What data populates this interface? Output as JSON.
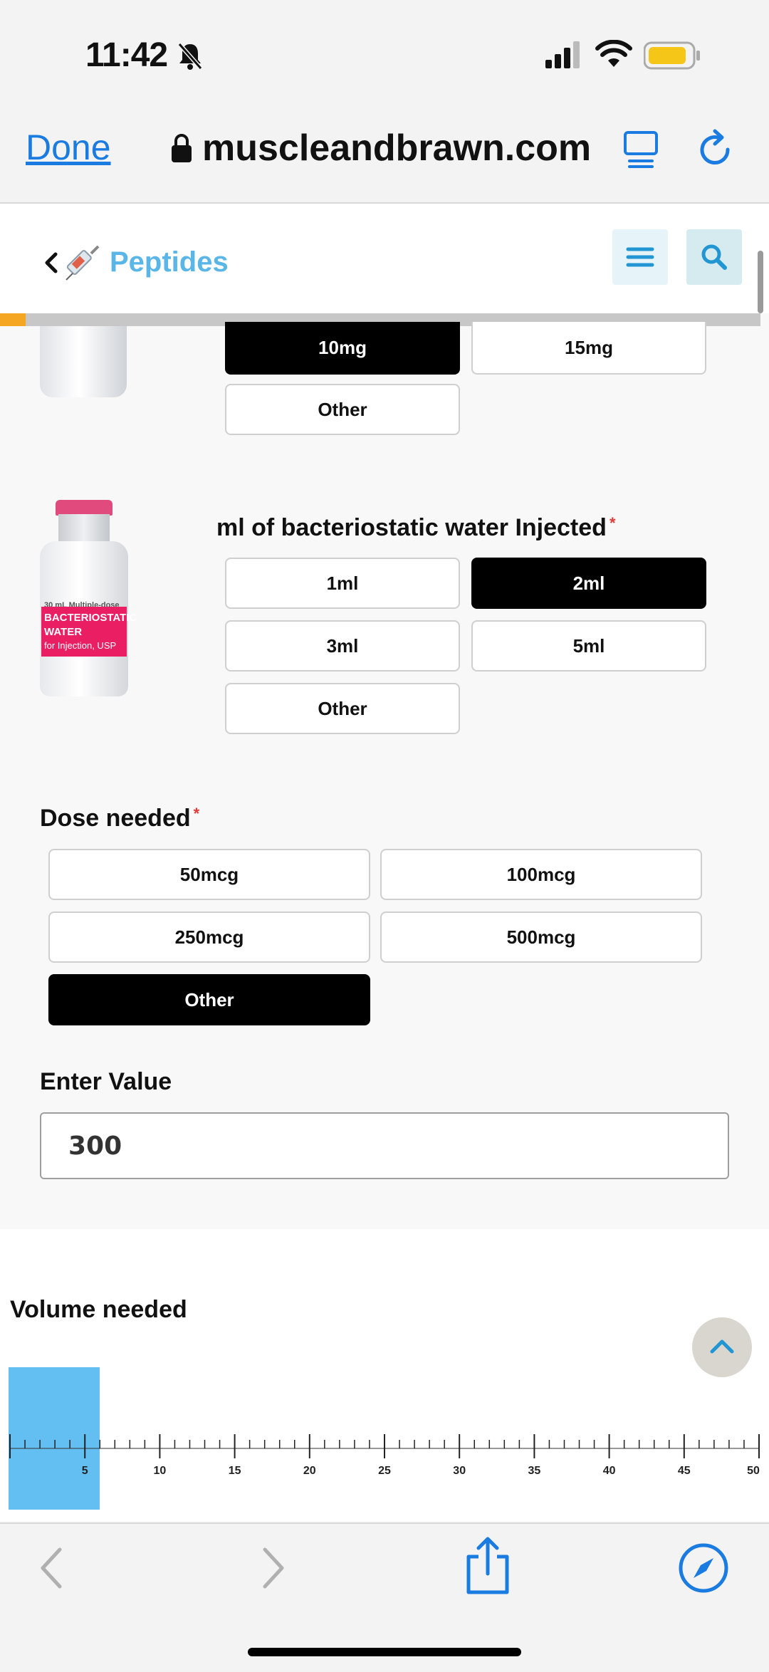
{
  "status_bar": {
    "time": "11:42"
  },
  "browser": {
    "done_label": "Done",
    "url": "muscleandbrawn.com"
  },
  "site_header": {
    "title": "Peptides"
  },
  "peptide_amount": {
    "options": [
      {
        "label": "10mg",
        "selected": true
      },
      {
        "label": "15mg",
        "selected": false
      },
      {
        "label": "Other",
        "selected": false
      }
    ]
  },
  "water": {
    "label": "ml of bacteriostatic water Injected",
    "required_mark": "*",
    "vial_text": [
      "30 mL Multiple-dose",
      "BACTERIOSTATIC",
      "WATER",
      "for Injection, USP"
    ],
    "options": [
      {
        "label": "1ml",
        "selected": false
      },
      {
        "label": "2ml",
        "selected": true
      },
      {
        "label": "3ml",
        "selected": false
      },
      {
        "label": "5ml",
        "selected": false
      },
      {
        "label": "Other",
        "selected": false
      }
    ]
  },
  "dose": {
    "label": "Dose needed",
    "required_mark": "*",
    "options": [
      {
        "label": "50mcg",
        "selected": false
      },
      {
        "label": "100mcg",
        "selected": false
      },
      {
        "label": "250mcg",
        "selected": false
      },
      {
        "label": "500mcg",
        "selected": false
      },
      {
        "label": "Other",
        "selected": true
      }
    ]
  },
  "enter_value": {
    "label": "Enter Value",
    "value": "300"
  },
  "volume": {
    "label": "Volume needed",
    "scale_labels": [
      "5",
      "10",
      "15",
      "20",
      "25",
      "30",
      "35",
      "40",
      "45",
      "50"
    ],
    "scale_max": 50,
    "selected_value": 6
  },
  "colors": {
    "accent": "#1a7be0",
    "brand": "#5bb6e8",
    "selected": "#000000",
    "slider": "#63bef2",
    "progress": "#f5a623"
  }
}
